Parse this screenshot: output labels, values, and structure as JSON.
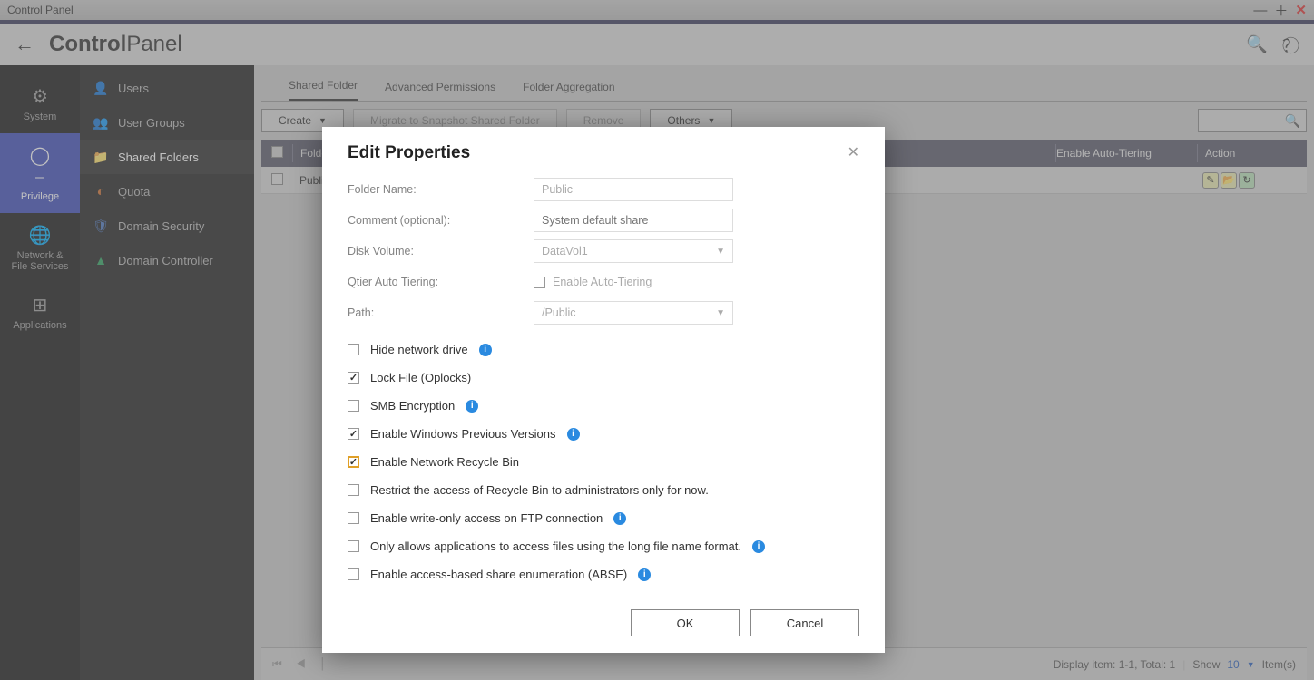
{
  "titlebar": {
    "title": "Control Panel"
  },
  "header": {
    "app_bold": "Control",
    "app_light": "Panel"
  },
  "rail": {
    "items": [
      {
        "label": "System"
      },
      {
        "label": "Privilege"
      },
      {
        "label": "Network &\nFile Services"
      },
      {
        "label": "Applications"
      }
    ]
  },
  "sidebar": {
    "items": [
      {
        "label": "Users"
      },
      {
        "label": "User Groups"
      },
      {
        "label": "Shared Folders"
      },
      {
        "label": "Quota"
      },
      {
        "label": "Domain Security"
      },
      {
        "label": "Domain Controller"
      }
    ]
  },
  "tabs": {
    "items": [
      "Shared Folder",
      "Advanced Permissions",
      "Folder Aggregation"
    ]
  },
  "toolbar": {
    "create": "Create",
    "migrate": "Migrate to Snapshot Shared Folder",
    "remove": "Remove",
    "others": "Others"
  },
  "table": {
    "headers": {
      "folder": "Folder",
      "tier": "Enable Auto-Tiering",
      "action": "Action"
    },
    "rows": [
      {
        "folder": "Public"
      }
    ]
  },
  "pager": {
    "display": "Display item: 1-1, Total: 1",
    "show": "Show",
    "show_value": "10",
    "items": "Item(s)"
  },
  "dialog": {
    "title": "Edit Properties",
    "labels": {
      "folder_name": "Folder Name:",
      "comment": "Comment (optional):",
      "volume": "Disk Volume:",
      "qtier": "Qtier Auto Tiering:",
      "path": "Path:"
    },
    "fields": {
      "folder_name": "Public",
      "comment_placeholder": "System default share",
      "volume": "DataVol1",
      "auto_tier": "Enable Auto-Tiering",
      "path": "/Public"
    },
    "checks": {
      "hide_drive": "Hide network drive",
      "lock_file": "Lock File (Oplocks)",
      "smb_enc": "SMB Encryption",
      "prev_versions": "Enable Windows Previous Versions",
      "recycle": "Enable Network Recycle Bin",
      "restrict_recycle": "Restrict the access of Recycle Bin to administrators only for now.",
      "ftp_write": "Enable write-only access on FTP connection",
      "long_name": "Only allows applications to access files using the long file name format.",
      "abse": "Enable access-based share enumeration (ABSE)"
    },
    "buttons": {
      "ok": "OK",
      "cancel": "Cancel"
    }
  }
}
